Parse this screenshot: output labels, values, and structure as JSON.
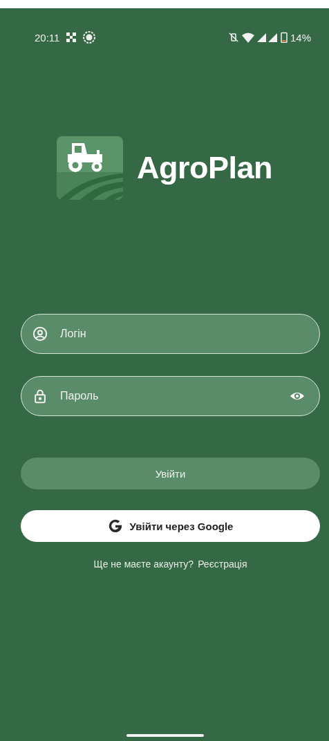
{
  "status_bar": {
    "time": "20:11",
    "battery": "14%"
  },
  "app": {
    "name": "AgroPlan"
  },
  "fields": [
    {
      "kind": "login",
      "placeholder": "Логін"
    },
    {
      "kind": "password",
      "placeholder": "Пароль"
    }
  ],
  "login_button": {
    "label": "Увійти"
  },
  "google_button": {
    "label": "Увійти через Google"
  },
  "signup": {
    "question": "Ще не маєте акаунту?",
    "link": "Реєстрація"
  }
}
